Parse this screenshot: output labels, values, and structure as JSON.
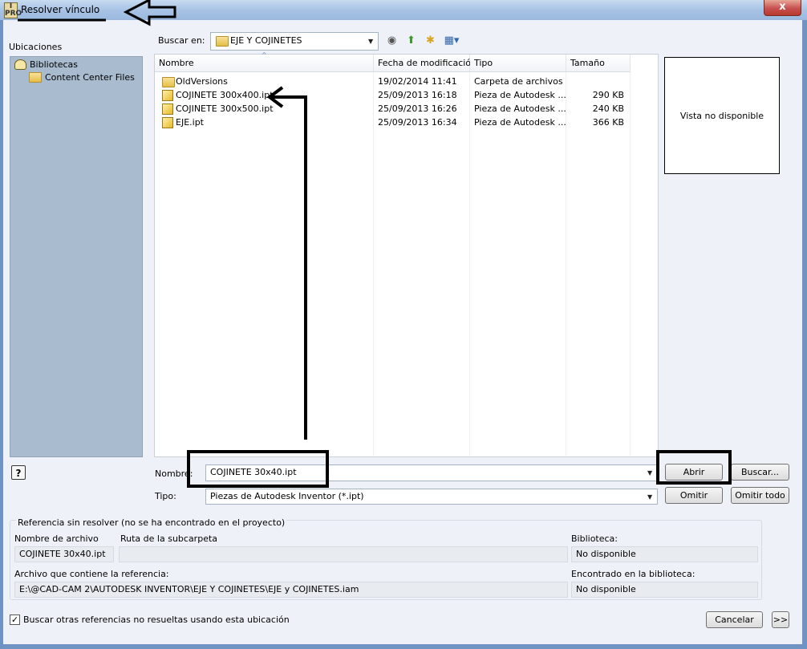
{
  "window": {
    "title": "Resolver vínculo",
    "icon": "inventor-app-icon",
    "close_label": "x"
  },
  "places": {
    "label": "Ubicaciones",
    "items": [
      {
        "label": "Bibliotecas",
        "icon": "library-icon"
      },
      {
        "label": "Content Center Files",
        "icon": "folder-icon"
      }
    ]
  },
  "lookin": {
    "label": "Buscar en:",
    "value": "EJE Y COJINETES"
  },
  "toolbar": {
    "icons": [
      "back-icon",
      "up-folder-icon",
      "new-folder-icon",
      "view-menu-icon"
    ]
  },
  "filelist": {
    "columns": [
      "Nombre",
      "Fecha de modificación",
      "Tipo",
      "Tamaño"
    ],
    "rows": [
      {
        "name": "OldVersions",
        "date": "19/02/2014 11:41",
        "type": "Carpeta de archivos",
        "size": "",
        "icon": "folder-icon"
      },
      {
        "name": "COJINETE 300x400.ipt",
        "date": "25/09/2013 16:18",
        "type": "Pieza de Autodesk ...",
        "size": "290 KB",
        "icon": "part-icon"
      },
      {
        "name": "COJINETE 300x500.ipt",
        "date": "25/09/2013 16:26",
        "type": "Pieza de Autodesk ...",
        "size": "240 KB",
        "icon": "part-icon"
      },
      {
        "name": "EJE.ipt",
        "date": "25/09/2013 16:34",
        "type": "Pieza de Autodesk ...",
        "size": "366 KB",
        "icon": "part-icon"
      }
    ]
  },
  "preview": {
    "text": "Vista no disponible"
  },
  "filename": {
    "label": "Nombre:",
    "value": "COJINETE 30x40.ipt"
  },
  "filetype": {
    "label": "Tipo:",
    "value": "Piezas de Autodesk Inventor (*.ipt)"
  },
  "buttons": {
    "open": "Abrir",
    "browse": "Buscar...",
    "skip": "Omitir",
    "skip_all": "Omitir todo",
    "cancel": "Cancelar",
    "expand": ">>",
    "help": "?"
  },
  "unresolved": {
    "title": "Referencia sin resolver (no se ha encontrado en el proyecto)",
    "file_name_label": "Nombre de archivo",
    "file_name": "COJINETE 30x40.ipt",
    "subfolder_label": "Ruta de la subcarpeta",
    "subfolder": "",
    "library_label": "Biblioteca:",
    "library": "No disponible",
    "container_label": "Archivo que contiene la referencia:",
    "container": "E:\\@CAD-CAM 2\\AUTODESK INVENTOR\\EJE Y COJINETES\\EJE y COJINETES.iam",
    "found_label": "Encontrado en la biblioteca:",
    "found": "No disponible"
  },
  "search_option": {
    "label": "Buscar otras referencias no resueltas usando esta ubicación",
    "checked": true
  }
}
